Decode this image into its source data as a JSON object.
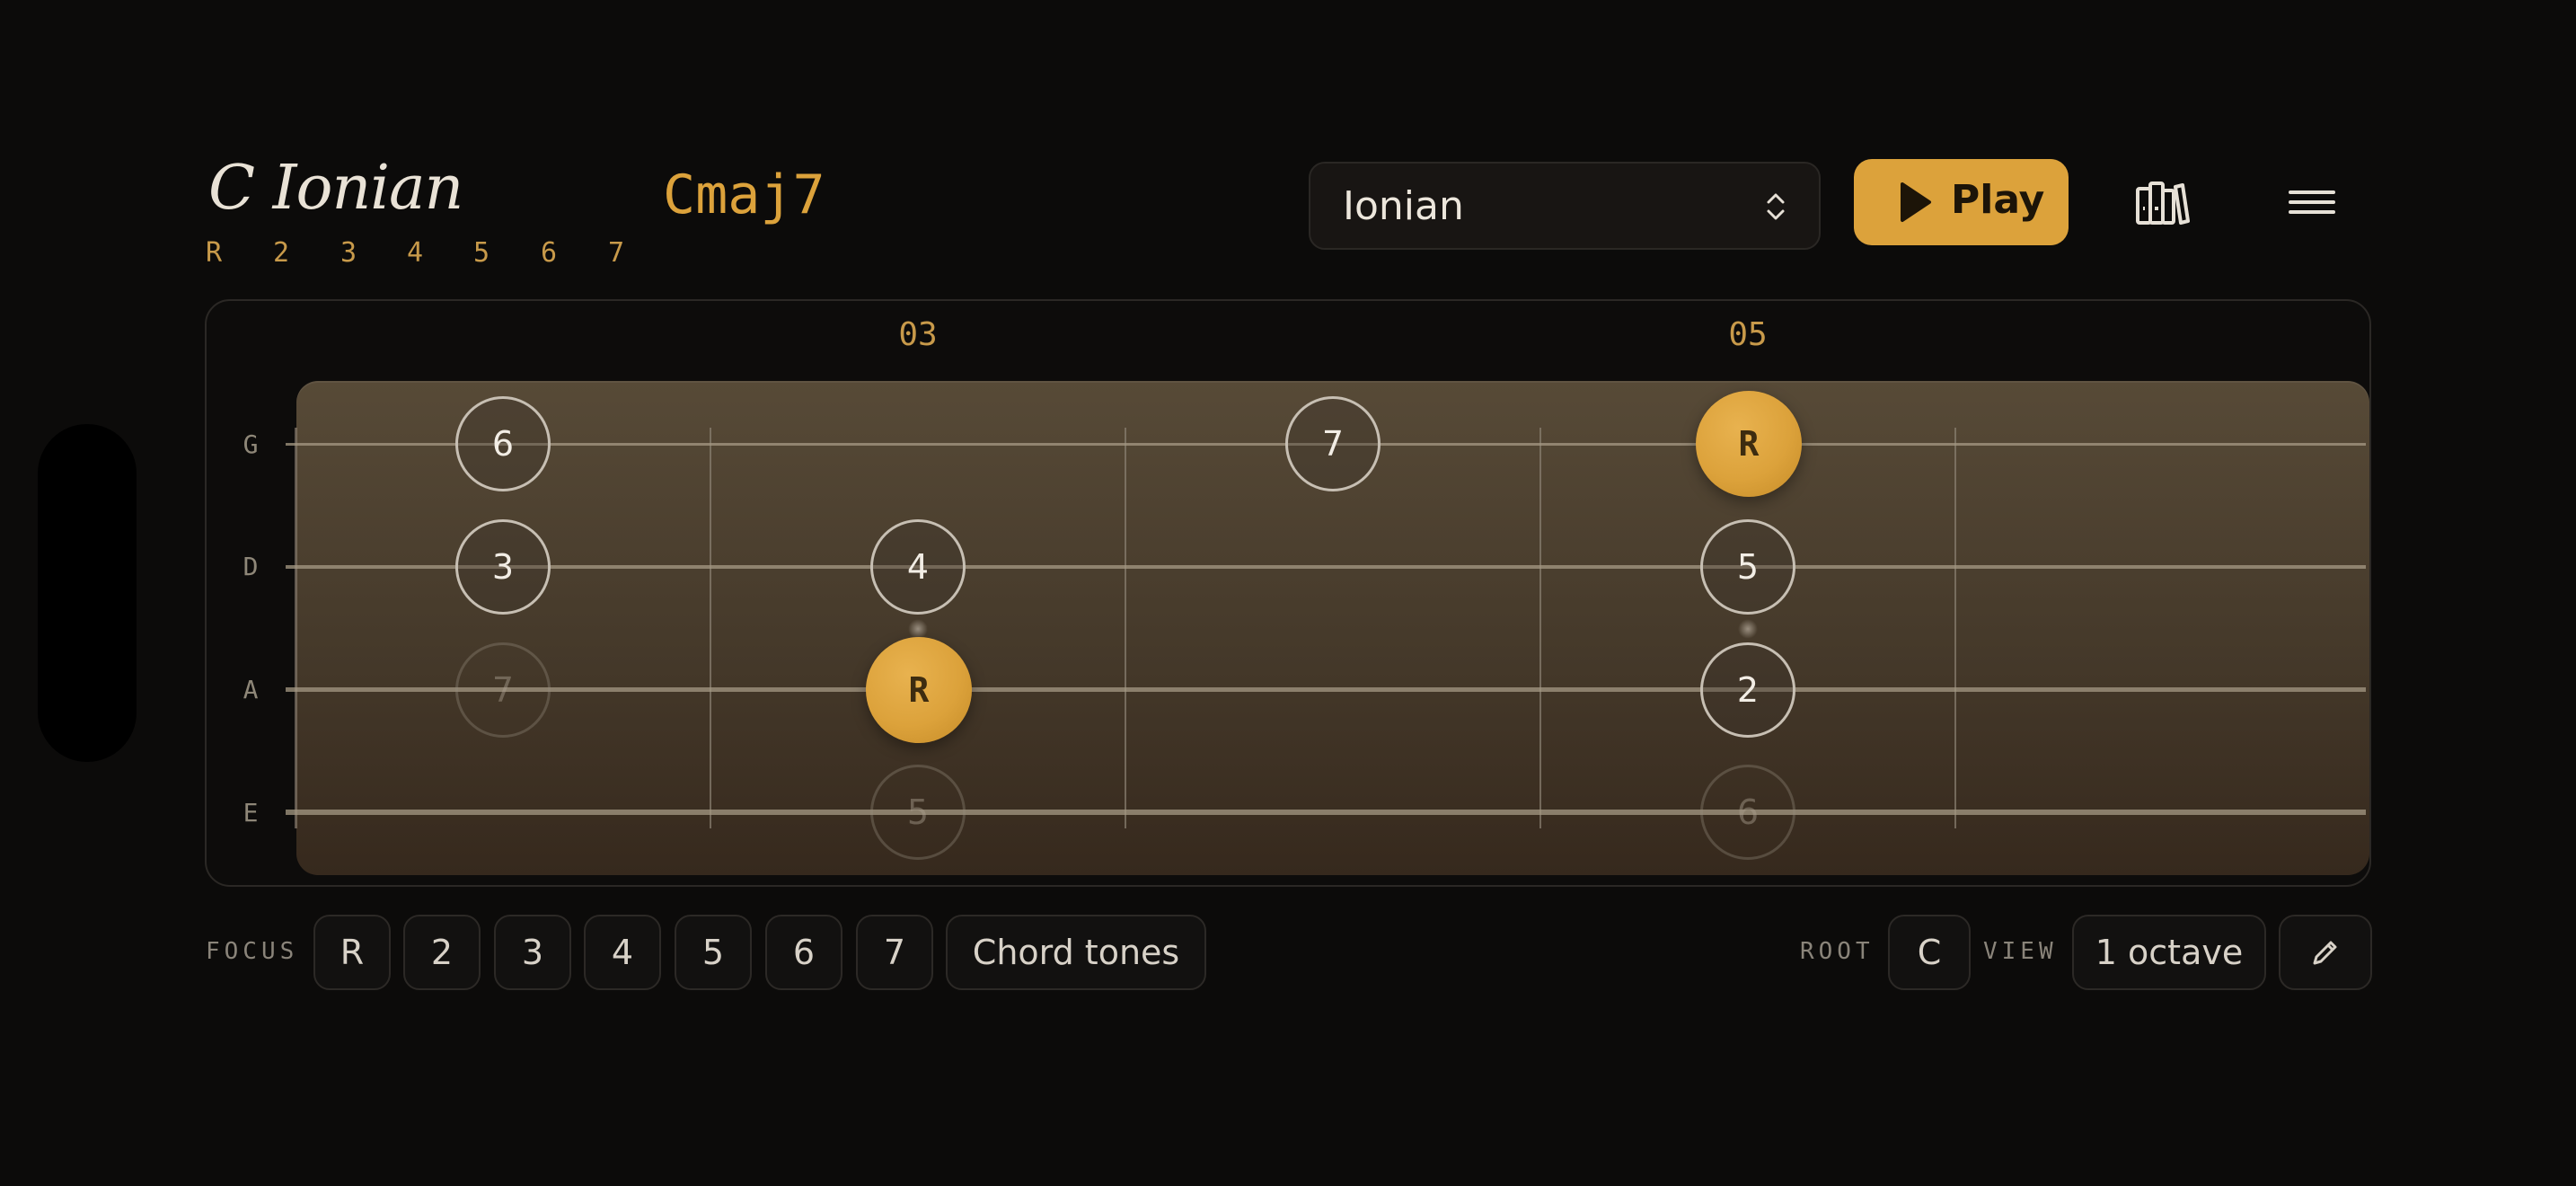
{
  "header": {
    "scale_title": "C Ionian",
    "chord_name": "Cmaj7",
    "degrees": [
      "R",
      "2",
      "3",
      "4",
      "5",
      "6",
      "7"
    ]
  },
  "toolbar": {
    "mode_select": {
      "value": "Ionian"
    },
    "play_label": "Play",
    "library_icon": "library-books-icon",
    "menu_icon": "hamburger-menu-icon"
  },
  "fretboard": {
    "fret_labels": [
      "03",
      "05"
    ],
    "strings": [
      "G",
      "D",
      "A",
      "E"
    ],
    "notes": [
      {
        "label": "6",
        "string": "G",
        "state": "tone"
      },
      {
        "label": "7",
        "string": "G",
        "state": "tone"
      },
      {
        "label": "R",
        "string": "G",
        "state": "root"
      },
      {
        "label": "3",
        "string": "D",
        "state": "tone"
      },
      {
        "label": "4",
        "string": "D",
        "state": "tone"
      },
      {
        "label": "5",
        "string": "D",
        "state": "tone"
      },
      {
        "label": "7",
        "string": "A",
        "state": "faded"
      },
      {
        "label": "R",
        "string": "A",
        "state": "root"
      },
      {
        "label": "2",
        "string": "A",
        "state": "tone"
      },
      {
        "label": "5",
        "string": "E",
        "state": "faded"
      },
      {
        "label": "6",
        "string": "E",
        "state": "faded"
      }
    ]
  },
  "controls": {
    "focus_label": "FOCUS",
    "focus_chips": [
      "R",
      "2",
      "3",
      "4",
      "5",
      "6",
      "7"
    ],
    "chord_tones_label": "Chord tones",
    "root_label": "ROOT",
    "root_value": "C",
    "view_label": "VIEW",
    "view_value": "1 octave",
    "edit_icon": "pencil-icon"
  },
  "colors": {
    "accent": "#dca23b",
    "background": "#0c0b0a",
    "fretboard_wood": "#4e4231"
  }
}
